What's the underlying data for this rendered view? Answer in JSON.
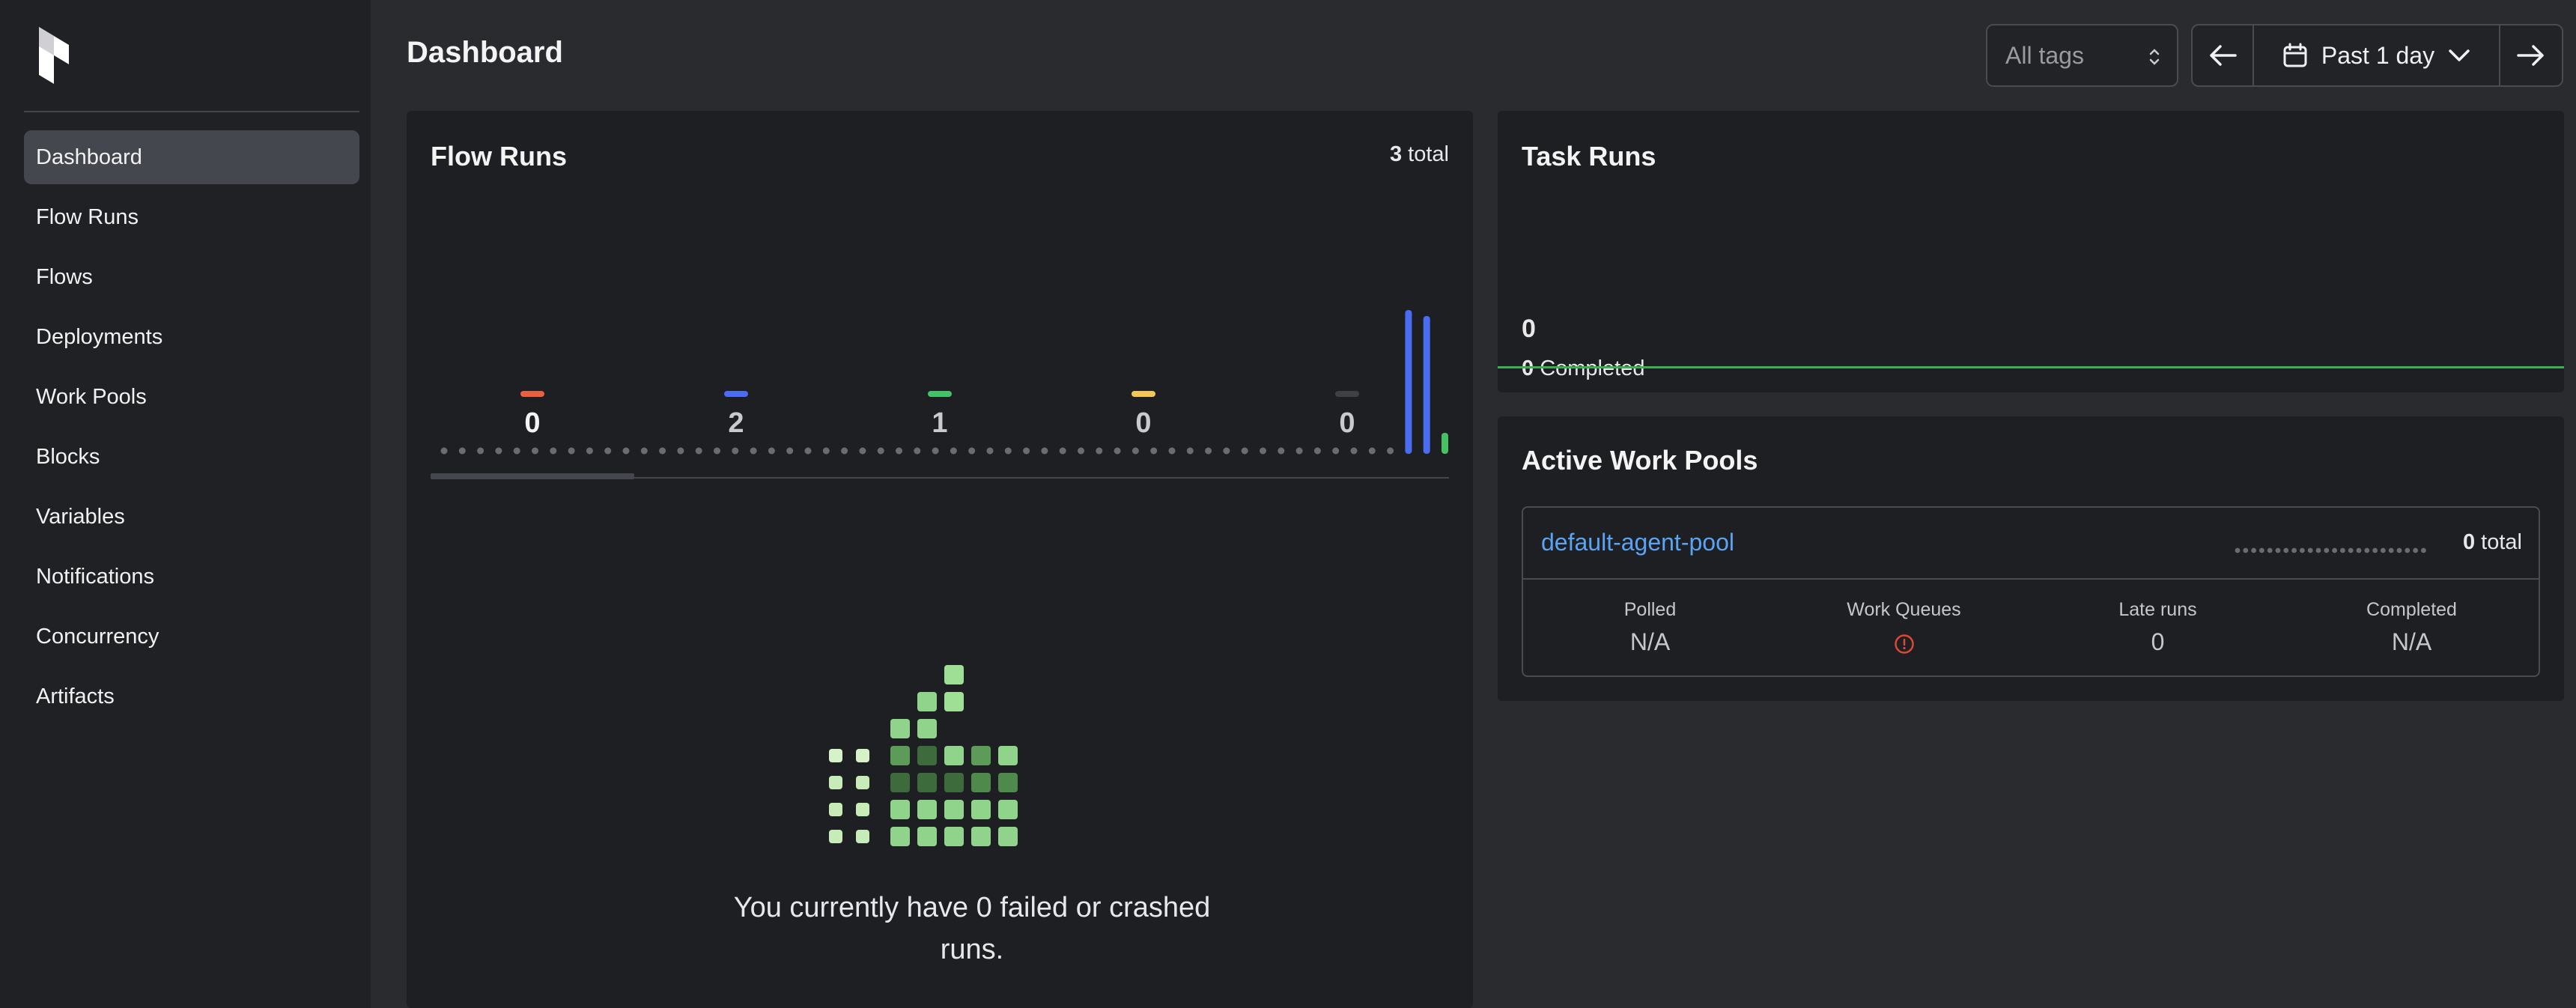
{
  "sidebar": {
    "items": [
      {
        "label": "Dashboard",
        "active": true
      },
      {
        "label": "Flow Runs"
      },
      {
        "label": "Flows"
      },
      {
        "label": "Deployments"
      },
      {
        "label": "Work Pools"
      },
      {
        "label": "Blocks"
      },
      {
        "label": "Variables"
      },
      {
        "label": "Notifications"
      },
      {
        "label": "Concurrency"
      },
      {
        "label": "Artifacts"
      }
    ]
  },
  "header": {
    "title": "Dashboard",
    "tags_select": "All tags",
    "date_range": "Past 1 day"
  },
  "flow_runs": {
    "title": "Flow Runs",
    "total_count": "3",
    "total_label": "total",
    "state_tabs": [
      {
        "state": "failed",
        "count": "0",
        "color": "#e5613f"
      },
      {
        "state": "running",
        "count": "2",
        "color": "#4a6cf0"
      },
      {
        "state": "completed",
        "count": "1",
        "color": "#45c265"
      },
      {
        "state": "late",
        "count": "0",
        "color": "#f1c75a"
      },
      {
        "state": "cancelled",
        "count": "0",
        "color": "#3f4045"
      }
    ],
    "empty_message": "You currently have 0 failed or crashed runs."
  },
  "chart_data": {
    "type": "bar",
    "title": "Flow Runs",
    "buckets": 56,
    "bars": [
      {
        "index": 53,
        "state": "running",
        "value": 1
      },
      {
        "index": 54,
        "state": "running",
        "value": 1
      },
      {
        "index": 55,
        "state": "completed",
        "value": 1
      }
    ]
  },
  "task_runs": {
    "title": "Task Runs",
    "count": "0",
    "completed_count": "0",
    "completed_label": "Completed"
  },
  "work_pools": {
    "title": "Active Work Pools",
    "pools": [
      {
        "name": "default-agent-pool",
        "total_count": "0",
        "total_label": "total",
        "stats": [
          {
            "label": "Polled",
            "value": "N/A"
          },
          {
            "label": "Work Queues",
            "value": ""
          },
          {
            "label": "Late runs",
            "value": "0"
          },
          {
            "label": "Completed",
            "value": "N/A"
          }
        ]
      }
    ]
  },
  "colors": {
    "accent": "#45474e",
    "link": "#5aa4f5",
    "success": "#45c265",
    "running": "#4a6cf0",
    "error": "#e5613f"
  }
}
